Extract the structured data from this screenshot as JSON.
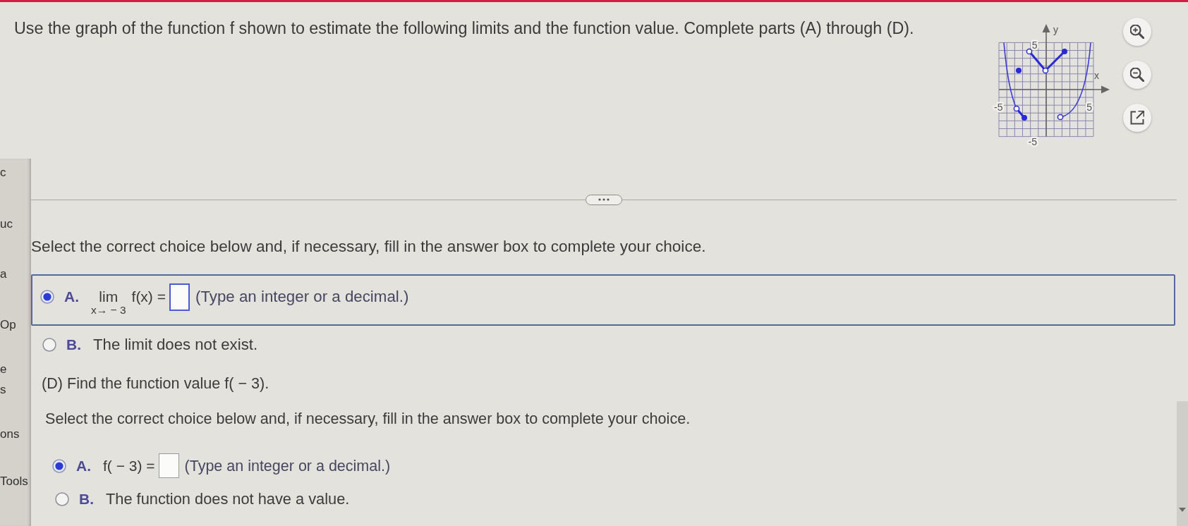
{
  "question": "Use the graph of the function f shown to estimate the following limits and the function value. Complete parts (A) through (D).",
  "graph": {
    "y_label": "y",
    "x_label": "x",
    "tick_labels": [
      "5",
      "-5",
      "5",
      "-5"
    ]
  },
  "side_panel": {
    "fragments": [
      "c",
      "uc",
      "a",
      "Op",
      "e",
      "s",
      "ons",
      "Tools"
    ]
  },
  "part_c": {
    "instruction": "Select the correct choice below and, if necessary, fill in the answer box to complete your choice.",
    "choices": [
      {
        "kind": "limit",
        "letter": "A.",
        "limit": "lim",
        "approach": "x→ − 3",
        "expression": "f(x) =",
        "hint": "(Type an integer or a decimal.)",
        "selected": true,
        "focused": true
      },
      {
        "kind": "statement",
        "letter": "B.",
        "text": "The limit does not exist.",
        "selected": false,
        "focused": false
      }
    ]
  },
  "part_d": {
    "heading": "(D) Find the function value f( − 3).",
    "instruction": "Select the correct choice below and, if necessary, fill in the answer box to complete your choice.",
    "choices": [
      {
        "kind": "value",
        "letter": "A.",
        "expression": "f( − 3) =",
        "hint": "(Type an integer or a decimal.)",
        "selected": true,
        "focused": false
      },
      {
        "kind": "statement",
        "letter": "B.",
        "text": "The function does not have a value.",
        "selected": false,
        "focused": false
      }
    ]
  }
}
